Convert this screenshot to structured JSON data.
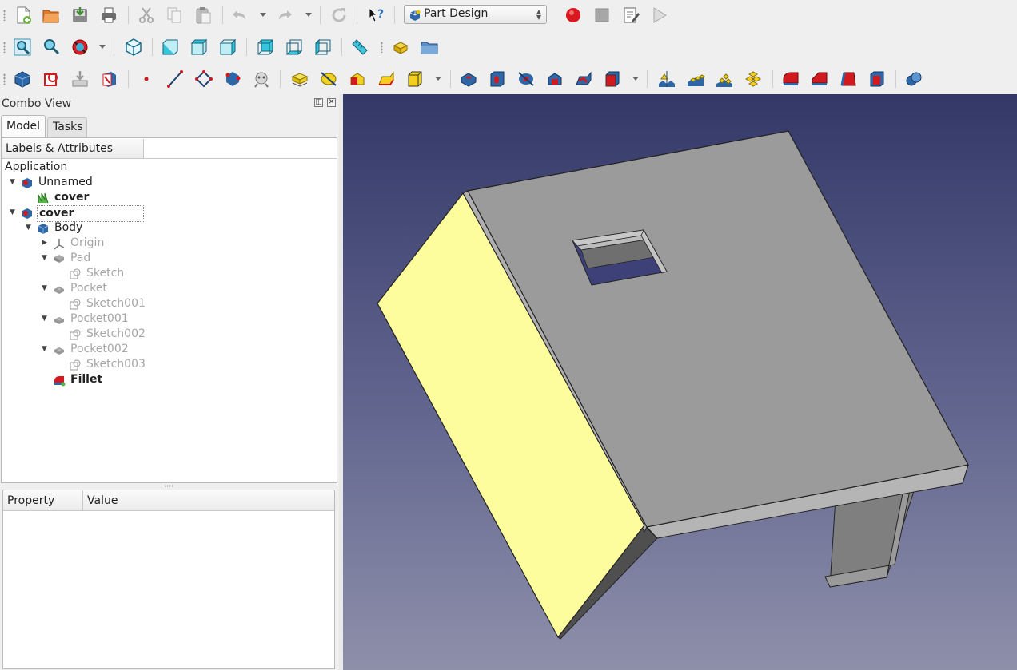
{
  "toolbar": {
    "row1": [
      "new-document-icon",
      "open-folder-icon",
      "save-icon",
      "print-icon",
      "cut-icon",
      "copy-icon",
      "paste-icon",
      "undo-icon",
      "redo-icon",
      "refresh-icon",
      "whats-this-icon",
      "record-macro-icon",
      "stop-macro-icon",
      "edit-macro-icon",
      "run-macro-icon"
    ],
    "workbench": "Part Design",
    "row2": [
      "fit-all-icon",
      "fit-selection-icon",
      "draw-style-icon",
      "isometric-view-icon",
      "front-view-icon",
      "top-view-icon",
      "right-view-icon",
      "rear-view-icon",
      "bottom-view-icon",
      "left-view-icon",
      "measure-distance-icon",
      "part-icon",
      "group-icon"
    ],
    "row3": [
      "body-icon",
      "create-sketch-icon",
      "validate-sketch-icon",
      "map-sketch-icon",
      "datum-point-icon",
      "datum-line-icon",
      "datum-plane-icon",
      "local-cs-icon",
      "shape-binder-icon",
      "pad-icon",
      "revolution-icon",
      "additive-loft-icon",
      "additive-pipe-icon",
      "additive-primitive-icon",
      "pocket-icon",
      "hole-icon",
      "groove-icon",
      "subtractive-loft-icon",
      "subtractive-pipe-icon",
      "subtractive-primitive-icon",
      "mirrored-icon",
      "linear-pattern-icon",
      "polar-pattern-icon",
      "multitransform-icon",
      "fillet-icon",
      "chamfer-icon",
      "draft-icon",
      "thickness-icon",
      "boolean-icon"
    ]
  },
  "combo": {
    "title": "Combo View",
    "float_button": "◫",
    "close_button": "✕",
    "tabs": [
      "Model",
      "Tasks"
    ],
    "tree_header": "Labels & Attributes",
    "tree": [
      {
        "label": "Application",
        "level": 0
      },
      {
        "label": "Unnamed",
        "level": 1,
        "icon": "document-icon"
      },
      {
        "label": "cover",
        "level": 2,
        "icon": "sketch-object-icon"
      },
      {
        "label": "cover",
        "level": 1,
        "icon": "document-icon"
      },
      {
        "label": "Body",
        "level": 2,
        "icon": "body-icon"
      },
      {
        "label": "Origin",
        "level": 3,
        "icon": "origin-icon"
      },
      {
        "label": "Pad",
        "level": 3,
        "icon": "pad-icon"
      },
      {
        "label": "Sketch",
        "level": 4,
        "icon": "sketch-icon"
      },
      {
        "label": "Pocket",
        "level": 3,
        "icon": "pocket-icon"
      },
      {
        "label": "Sketch001",
        "level": 4,
        "icon": "sketch-icon"
      },
      {
        "label": "Pocket001",
        "level": 3,
        "icon": "pocket-icon"
      },
      {
        "label": "Sketch002",
        "level": 4,
        "icon": "sketch-icon"
      },
      {
        "label": "Pocket002",
        "level": 3,
        "icon": "pocket-icon"
      },
      {
        "label": "Sketch003",
        "level": 4,
        "icon": "sketch-icon"
      },
      {
        "label": "Fillet",
        "level": 3,
        "icon": "fillet-icon"
      }
    ],
    "property_headers": [
      "Property",
      "Value"
    ]
  },
  "colors": {
    "viewport_top": "#343867",
    "viewport_bottom": "#8e90aa",
    "model_face": "#9b9b9b",
    "selected_face": "#fdfd9e"
  }
}
